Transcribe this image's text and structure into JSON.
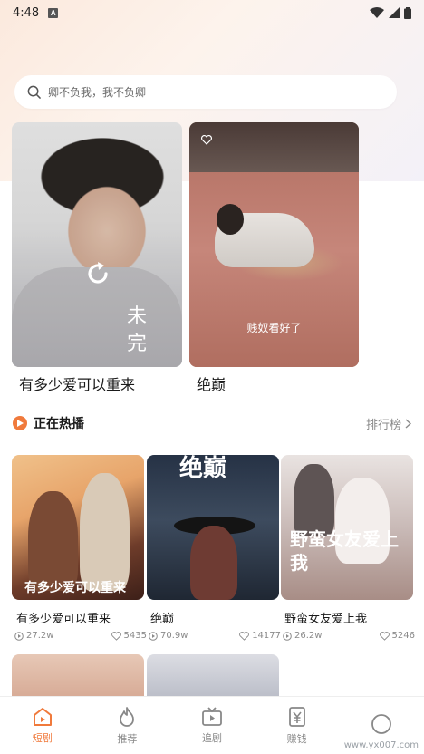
{
  "status_bar": {
    "time": "4:48",
    "badge": "A"
  },
  "search": {
    "placeholder": "卿不负我，我不负卿"
  },
  "featured": [
    {
      "title": "有多少爱可以重来",
      "overlay_text": "未完"
    },
    {
      "title": "绝巅",
      "subtitle": "贱奴看好了"
    }
  ],
  "section": {
    "title": "正在热播",
    "more_label": "排行榜"
  },
  "dramas": [
    {
      "name": "有多少爱可以重来",
      "poster_text": "有多少爱可以重来",
      "views": "27.2w",
      "likes": "5435"
    },
    {
      "name": "绝巅",
      "poster_text": "绝巅",
      "views": "70.9w",
      "likes": "14177"
    },
    {
      "name": "野蛮女友爱上我",
      "poster_text": "野蛮女友爱上我",
      "views": "26.2w",
      "likes": "5246"
    }
  ],
  "tabs": [
    {
      "label": "短剧",
      "icon": "home-icon",
      "active": true
    },
    {
      "label": "推荐",
      "icon": "flame-icon",
      "active": false
    },
    {
      "label": "追剧",
      "icon": "tv-icon",
      "active": false
    },
    {
      "label": "赚钱",
      "icon": "money-icon",
      "active": false
    },
    {
      "label": "",
      "icon": "profile-icon",
      "active": false
    }
  ],
  "watermark": "www.yx007.com",
  "colors": {
    "accent": "#f07a3c"
  }
}
